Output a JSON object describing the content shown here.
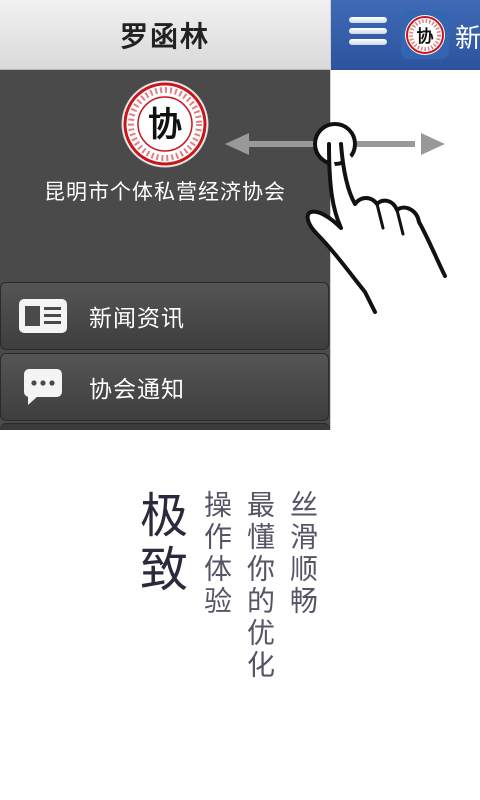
{
  "drawer": {
    "user_name": "罗函林",
    "org_logo_text": "协",
    "org_name": "昆明市个体私营经济协会",
    "menu": [
      {
        "label": "新闻资讯",
        "icon": "news-icon"
      },
      {
        "label": "协会通知",
        "icon": "chat-bubble-icon"
      }
    ]
  },
  "main": {
    "title_partial": "新",
    "menu_icon": "hamburger-menu-icon",
    "logo_text": "协"
  },
  "gesture": {
    "icon": "swipe-hand-icon"
  },
  "slogan": {
    "main": "极致",
    "line1": "操作体验",
    "line2": "最懂你的优化",
    "line3": "丝滑顺畅"
  },
  "colors": {
    "topbar_blue": "#2c549e",
    "drawer_gray": "#4a4a4a",
    "logo_red": "#c8161d"
  }
}
